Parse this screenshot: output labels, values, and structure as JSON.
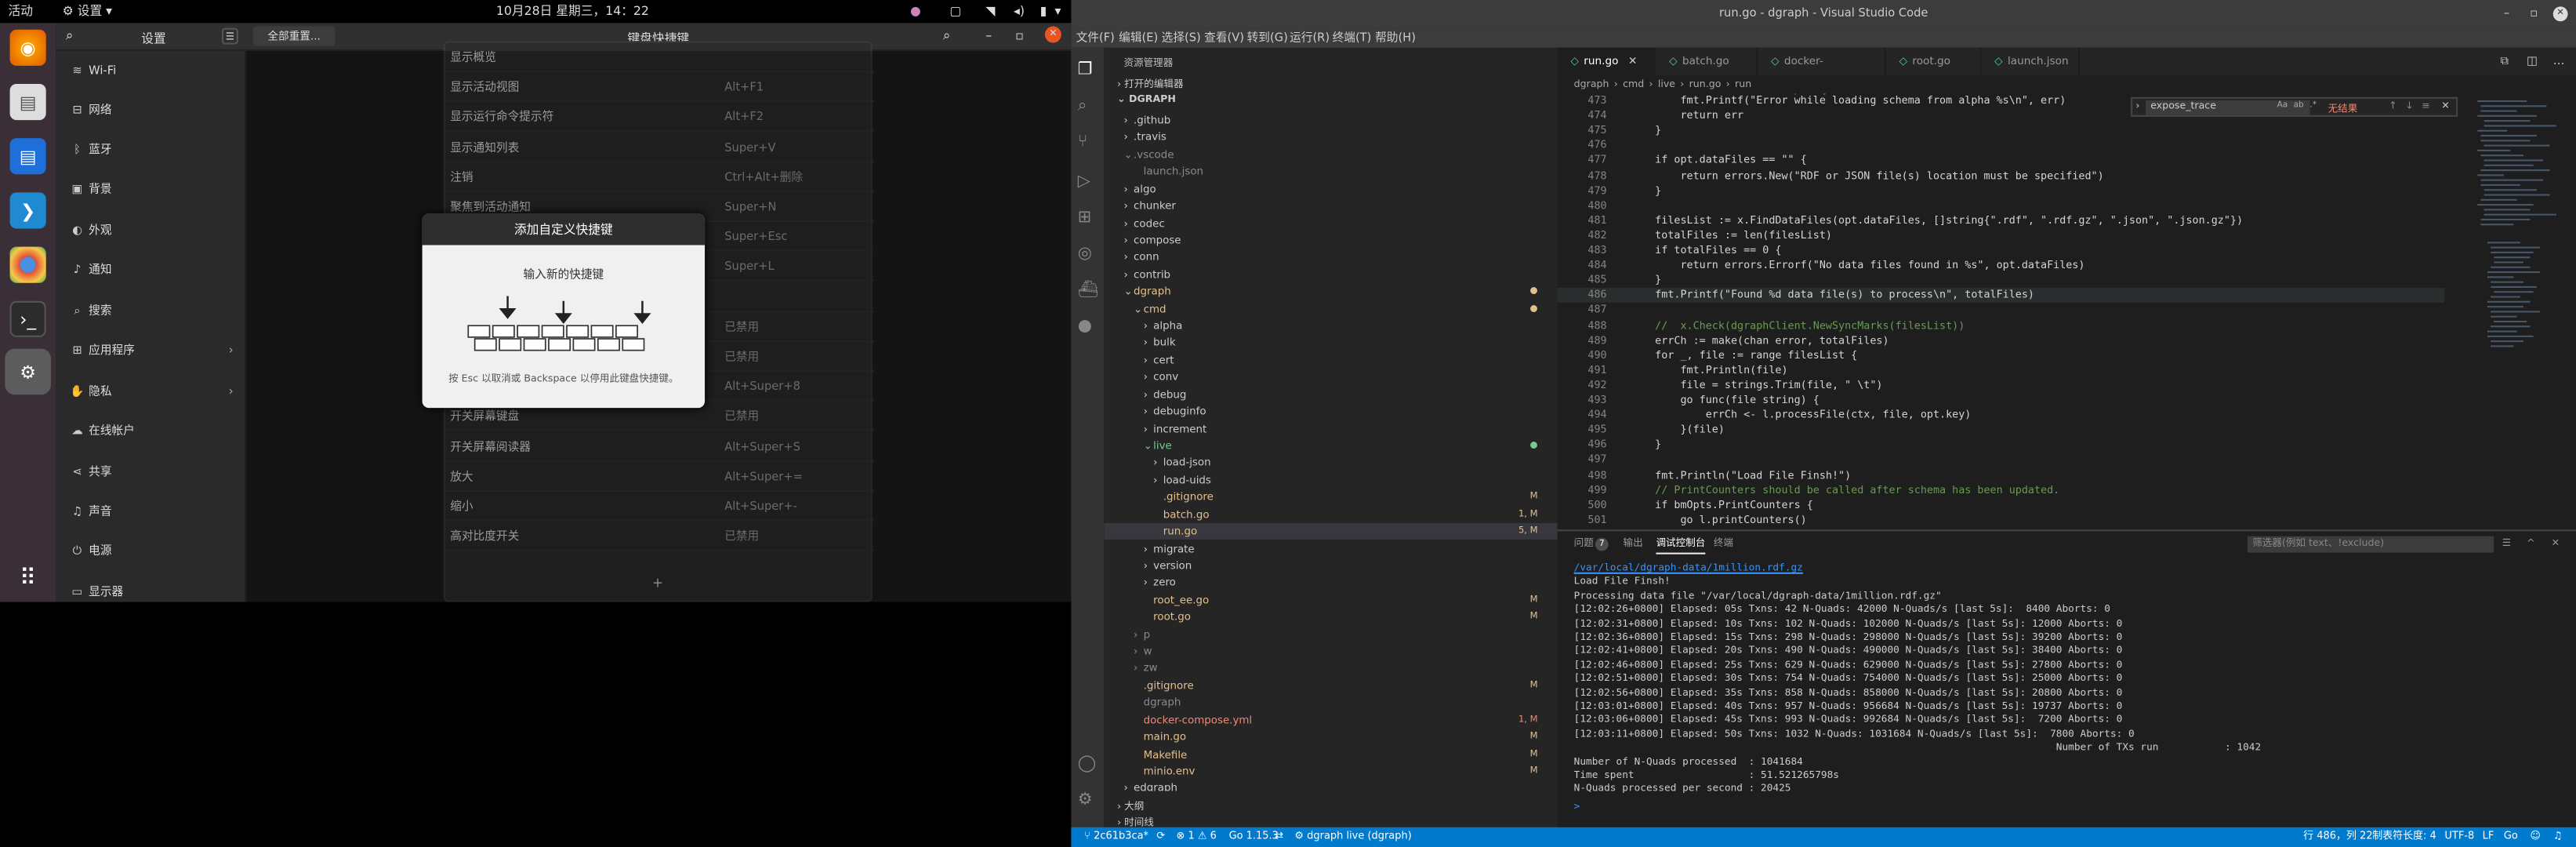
{
  "topbar": {
    "activities": "活动",
    "app_menu": "设置",
    "clock": "10月28日 星期三，14：22"
  },
  "settings": {
    "sidebar_title": "设置",
    "reset_button": "全部重置...",
    "header_title": "键盘快捷键",
    "sidebar_items": [
      {
        "icon": "wifi-icon",
        "glyph": "≋",
        "label": "Wi-Fi"
      },
      {
        "icon": "network-icon",
        "glyph": "⊟",
        "label": "网络"
      },
      {
        "icon": "bluetooth-icon",
        "glyph": "ᛒ",
        "label": "蓝牙"
      },
      {
        "icon": "background-icon",
        "glyph": "▣",
        "label": "背景"
      },
      {
        "icon": "appearance-icon",
        "glyph": "◐",
        "label": "外观"
      },
      {
        "icon": "notifications-icon",
        "glyph": "♪",
        "label": "通知"
      },
      {
        "icon": "search-icon",
        "glyph": "⌕",
        "label": "搜索"
      },
      {
        "icon": "applications-icon",
        "glyph": "⊞",
        "label": "应用程序",
        "arrow": "›"
      },
      {
        "icon": "privacy-icon",
        "glyph": "✋",
        "label": "隐私",
        "arrow": "›"
      },
      {
        "icon": "online-accounts-icon",
        "glyph": "☁",
        "label": "在线帐户"
      },
      {
        "icon": "sharing-icon",
        "glyph": "⋖",
        "label": "共享"
      },
      {
        "icon": "sound-icon",
        "glyph": "♫",
        "label": "声音"
      },
      {
        "icon": "power-icon",
        "glyph": "⏻",
        "label": "电源"
      },
      {
        "icon": "displays-icon",
        "glyph": "▭",
        "label": "显示器"
      }
    ],
    "shortcuts": [
      {
        "name": "显示概览",
        "accel": ""
      },
      {
        "name": "显示活动视图",
        "accel": "Alt+F1"
      },
      {
        "name": "显示运行命令提示符",
        "accel": "Alt+F2"
      },
      {
        "name": "显示通知列表",
        "accel": "Super+V"
      },
      {
        "name": "注销",
        "accel": "Ctrl+Alt+删除"
      },
      {
        "name": "聚焦到活动通知",
        "accel": "Super+N"
      },
      {
        "name": "",
        "accel": "Super+Esc"
      },
      {
        "name": "",
        "accel": "Super+L"
      },
      {
        "name": "",
        "accel": ""
      },
      {
        "name": "",
        "accel": "已禁用"
      },
      {
        "name": "",
        "accel": "已禁用"
      },
      {
        "name": "",
        "accel": "Alt+Super+8"
      },
      {
        "name": "开关屏幕键盘",
        "accel": "已禁用"
      },
      {
        "name": "开关屏幕阅读器",
        "accel": "Alt+Super+S"
      },
      {
        "name": "放大",
        "accel": "Alt+Super+="
      },
      {
        "name": "缩小",
        "accel": "Alt+Super+-"
      },
      {
        "name": "高对比度开关",
        "accel": "已禁用"
      }
    ],
    "add_button": "+",
    "dialog": {
      "title": "添加自定义快捷键",
      "prompt": "输入新的快捷键",
      "hint": "按 Esc 以取消或 Backspace 以停用此键盘快捷键。"
    }
  },
  "vscode": {
    "title": "run.go - dgraph - Visual Studio Code",
    "menu": [
      "文件(F)",
      "编辑(E)",
      "选择(S)",
      "查看(V)",
      "转到(G)",
      "运行(R)",
      "终端(T)",
      "帮助(H)"
    ],
    "explorer_title": "资源管理器",
    "open_editors": "打开的编辑器",
    "project": "DGRAPH",
    "tree": [
      {
        "label": ".github",
        "depth": 1,
        "type": "folder",
        "color": "#cccccc"
      },
      {
        "label": ".travis",
        "depth": 1,
        "type": "folder",
        "color": "#cccccc"
      },
      {
        "label": ".vscode",
        "depth": 1,
        "type": "folder-open",
        "color": "#8a8a8a"
      },
      {
        "label": "launch.json",
        "depth": 2,
        "type": "file",
        "color": "#8a8a8a"
      },
      {
        "label": "algo",
        "depth": 1,
        "type": "folder",
        "color": "#cccccc"
      },
      {
        "label": "chunker",
        "depth": 1,
        "type": "folder",
        "color": "#cccccc"
      },
      {
        "label": "codec",
        "depth": 1,
        "type": "folder",
        "color": "#cccccc"
      },
      {
        "label": "compose",
        "depth": 1,
        "type": "folder",
        "color": "#cccccc"
      },
      {
        "label": "conn",
        "depth": 1,
        "type": "folder",
        "color": "#cccccc"
      },
      {
        "label": "contrib",
        "depth": 1,
        "type": "folder",
        "color": "#cccccc"
      },
      {
        "label": "dgraph",
        "depth": 1,
        "type": "folder-open",
        "color": "#e2c08d",
        "badge": "●"
      },
      {
        "label": "cmd",
        "depth": 2,
        "type": "folder-open",
        "color": "#e2c08d",
        "badge": "●"
      },
      {
        "label": "alpha",
        "depth": 3,
        "type": "folder",
        "color": "#cccccc"
      },
      {
        "label": "bulk",
        "depth": 3,
        "type": "folder",
        "color": "#cccccc"
      },
      {
        "label": "cert",
        "depth": 3,
        "type": "folder",
        "color": "#cccccc"
      },
      {
        "label": "conv",
        "depth": 3,
        "type": "folder",
        "color": "#cccccc"
      },
      {
        "label": "debug",
        "depth": 3,
        "type": "folder",
        "color": "#cccccc"
      },
      {
        "label": "debuginfo",
        "depth": 3,
        "type": "folder",
        "color": "#cccccc"
      },
      {
        "label": "increment",
        "depth": 3,
        "type": "folder",
        "color": "#cccccc"
      },
      {
        "label": "live",
        "depth": 3,
        "type": "folder-open",
        "color": "#73c991",
        "badge": "●"
      },
      {
        "label": "load-json",
        "depth": 4,
        "type": "folder",
        "color": "#cccccc"
      },
      {
        "label": "load-uids",
        "depth": 4,
        "type": "folder",
        "color": "#cccccc"
      },
      {
        "label": ".gitignore",
        "depth": 4,
        "type": "file",
        "color": "#e2c08d",
        "badge": "M"
      },
      {
        "label": "batch.go",
        "depth": 4,
        "type": "file",
        "color": "#e2c08d",
        "badge": "1, M"
      },
      {
        "label": "run.go",
        "depth": 4,
        "type": "file",
        "color": "#e2c08d",
        "badge": "5, M",
        "selected": true
      },
      {
        "label": "migrate",
        "depth": 3,
        "type": "folder",
        "color": "#cccccc"
      },
      {
        "label": "version",
        "depth": 3,
        "type": "folder",
        "color": "#cccccc"
      },
      {
        "label": "zero",
        "depth": 3,
        "type": "folder",
        "color": "#cccccc"
      },
      {
        "label": "root_ee.go",
        "depth": 3,
        "type": "file",
        "color": "#e2c08d",
        "badge": "M"
      },
      {
        "label": "root.go",
        "depth": 3,
        "type": "file",
        "color": "#e2c08d",
        "badge": "M"
      },
      {
        "label": "p",
        "depth": 2,
        "type": "folder",
        "color": "#8a8a8a"
      },
      {
        "label": "w",
        "depth": 2,
        "type": "folder",
        "color": "#8a8a8a"
      },
      {
        "label": "zw",
        "depth": 2,
        "type": "folder",
        "color": "#8a8a8a"
      },
      {
        "label": ".gitignore",
        "depth": 2,
        "type": "file",
        "color": "#e2c08d",
        "badge": "M"
      },
      {
        "label": "dgraph",
        "depth": 2,
        "type": "file",
        "color": "#8a8a8a"
      },
      {
        "label": "docker-compose.yml",
        "depth": 2,
        "type": "file",
        "color": "#f48771",
        "badge": "1, M"
      },
      {
        "label": "main.go",
        "depth": 2,
        "type": "file",
        "color": "#e2c08d",
        "badge": "M"
      },
      {
        "label": "Makefile",
        "depth": 2,
        "type": "file",
        "color": "#e2c08d",
        "badge": "M"
      },
      {
        "label": "minio.env",
        "depth": 2,
        "type": "file",
        "color": "#e2c08d",
        "badge": "M"
      },
      {
        "label": "edgraph",
        "depth": 1,
        "type": "folder",
        "color": "#cccccc"
      }
    ],
    "outline": "大纲",
    "timeline": "时间线",
    "tabs": [
      {
        "label": "run.go",
        "active": true,
        "icon": "go-file-icon"
      },
      {
        "label": "batch.go",
        "active": false,
        "icon": "go-file-icon"
      },
      {
        "label": "docker-compose.yml",
        "active": false,
        "icon": "docker-file-icon"
      },
      {
        "label": "root.go",
        "active": false,
        "icon": "go-file-icon"
      },
      {
        "label": "launch.json",
        "active": false,
        "icon": "json-file-icon"
      }
    ],
    "breadcrumb": [
      "dgraph",
      "cmd",
      "live",
      "run.go",
      "run"
    ],
    "find": {
      "value": "expose_trace",
      "result": "无结果"
    },
    "code": [
      {
        "n": "473",
        "t": "        fmt.Printf(\"Error while loading schema from alpha %s\\n\", err)"
      },
      {
        "n": "474",
        "t": "        return err"
      },
      {
        "n": "475",
        "t": "    }"
      },
      {
        "n": "476",
        "t": ""
      },
      {
        "n": "477",
        "t": "    if opt.dataFiles == \"\" {"
      },
      {
        "n": "478",
        "t": "        return errors.New(\"RDF or JSON file(s) location must be specified\")"
      },
      {
        "n": "479",
        "t": "    }"
      },
      {
        "n": "480",
        "t": ""
      },
      {
        "n": "481",
        "t": "    filesList := x.FindDataFiles(opt.dataFiles, []string{\".rdf\", \".rdf.gz\", \".json\", \".json.gz\"})"
      },
      {
        "n": "482",
        "t": "    totalFiles := len(filesList)"
      },
      {
        "n": "483",
        "t": "    if totalFiles == 0 {"
      },
      {
        "n": "484",
        "t": "        return errors.Errorf(\"No data files found in %s\", opt.dataFiles)"
      },
      {
        "n": "485",
        "t": "    }"
      },
      {
        "n": "486",
        "t": "    fmt.Printf(\"Found %d data file(s) to process\\n\", totalFiles)"
      },
      {
        "n": "487",
        "t": ""
      },
      {
        "n": "488",
        "t": "    //  x.Check(dgraphClient.NewSyncMarks(filesList))"
      },
      {
        "n": "489",
        "t": "    errCh := make(chan error, totalFiles)"
      },
      {
        "n": "490",
        "t": "    for _, file := range filesList {"
      },
      {
        "n": "491",
        "t": "        fmt.Println(file)"
      },
      {
        "n": "492",
        "t": "        file = strings.Trim(file, \" \\t\")"
      },
      {
        "n": "493",
        "t": "        go func(file string) {"
      },
      {
        "n": "494",
        "t": "            errCh <- l.processFile(ctx, file, opt.key)"
      },
      {
        "n": "495",
        "t": "        }(file)"
      },
      {
        "n": "496",
        "t": "    }"
      },
      {
        "n": "497",
        "t": ""
      },
      {
        "n": "498",
        "t": "    fmt.Println(\"Load File Finsh!\")"
      },
      {
        "n": "499",
        "t": "    // PrintCounters should be called after schema has been updated."
      },
      {
        "n": "500",
        "t": "    if bmOpts.PrintCounters {"
      },
      {
        "n": "501",
        "t": "        go l.printCounters()"
      }
    ],
    "panel_tabs": [
      "问题",
      "输出",
      "调试控制台",
      "终端"
    ],
    "problems_count": "7",
    "filter_placeholder": "筛选器(例如 text、!exclude)",
    "terminal": [
      "/var/local/dgraph-data/1million.rdf.gz",
      "Load File Finsh!",
      "Processing data file \"/var/local/dgraph-data/1million.rdf.gz\"",
      "[12:02:26+0800] Elapsed: 05s Txns: 42 N-Quads: 42000 N-Quads/s [last 5s]:  8400 Aborts: 0",
      "[12:02:31+0800] Elapsed: 10s Txns: 102 N-Quads: 102000 N-Quads/s [last 5s]: 12000 Aborts: 0",
      "[12:02:36+0800] Elapsed: 15s Txns: 298 N-Quads: 298000 N-Quads/s [last 5s]: 39200 Aborts: 0",
      "[12:02:41+0800] Elapsed: 20s Txns: 490 N-Quads: 490000 N-Quads/s [last 5s]: 38400 Aborts: 0",
      "[12:02:46+0800] Elapsed: 25s Txns: 629 N-Quads: 629000 N-Quads/s [last 5s]: 27800 Aborts: 0",
      "[12:02:51+0800] Elapsed: 30s Txns: 754 N-Quads: 754000 N-Quads/s [last 5s]: 25000 Aborts: 0",
      "[12:02:56+0800] Elapsed: 35s Txns: 858 N-Quads: 858000 N-Quads/s [last 5s]: 20800 Aborts: 0",
      "[12:03:01+0800] Elapsed: 40s Txns: 957 N-Quads: 956684 N-Quads/s [last 5s]: 19737 Aborts: 0",
      "[12:03:06+0800] Elapsed: 45s Txns: 993 N-Quads: 992684 N-Quads/s [last 5s]:  7200 Aborts: 0",
      "[12:03:11+0800] Elapsed: 50s Txns: 1032 N-Quads: 1031684 N-Quads/s [last 5s]:  7800 Aborts: 0",
      "                                                                                Number of TXs run           : 1042",
      "Number of N-Quads processed  : 1041684",
      "Time spent                   : 51.521265798s",
      "N-Quads processed per second : 20425"
    ],
    "prompt": ">",
    "status": {
      "branch": "2c61b3ca*",
      "errors": "1",
      "warnings": "6",
      "go": "Go 1.15.3",
      "debug": "dgraph live (dgraph)",
      "position": "行 486，列 22",
      "tab": "制表符长度: 4",
      "encoding": "UTF-8",
      "eol": "LF",
      "lang": "Go"
    }
  },
  "colors": {
    "vscode_blue": "#007acc",
    "ubuntu_dock": "#3a2f36",
    "close_red": "#e95420"
  }
}
